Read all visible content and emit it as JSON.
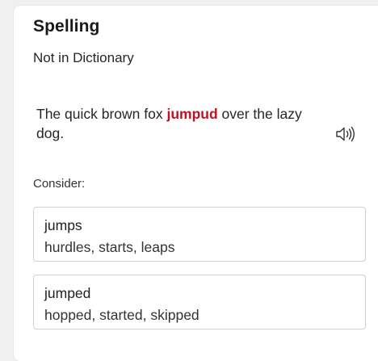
{
  "pane": {
    "title": "Spelling",
    "subtitle": "Not in Dictionary"
  },
  "sentence": {
    "before": "The quick brown fox ",
    "error_word": "jumpud",
    "after": " over the lazy dog.",
    "error_color": "#c50f1f"
  },
  "read_aloud": {
    "icon": "speaker-icon"
  },
  "consider": {
    "label": "Consider:",
    "suggestions": [
      {
        "word": "jumps",
        "synonyms": "hurdles, starts, leaps"
      },
      {
        "word": "jumped",
        "synonyms": "hopped, started, skipped"
      }
    ]
  }
}
